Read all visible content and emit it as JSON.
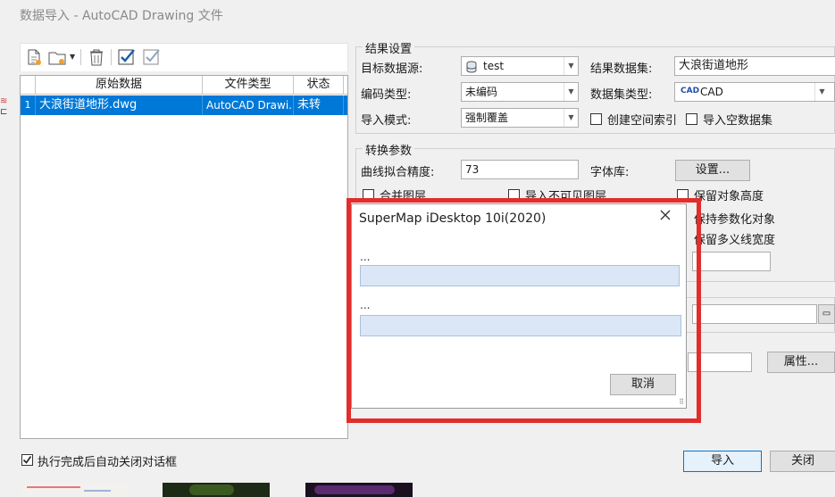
{
  "window": {
    "title": "数据导入 - AutoCAD Drawing 文件"
  },
  "toolbar": {
    "icons": [
      "add-file-icon",
      "add-folder-icon",
      "delete-icon",
      "select-all-icon",
      "select-invert-icon"
    ]
  },
  "table": {
    "columns": [
      "原始数据",
      "文件类型",
      "状态"
    ],
    "rows": [
      {
        "index": "1",
        "name": "大浪街道地形.dwg",
        "type": "AutoCAD Drawi...",
        "status": "未转"
      }
    ]
  },
  "result": {
    "group_title": "结果设置",
    "target_ds_label": "目标数据源:",
    "target_ds_value": "test",
    "result_dataset_label": "结果数据集:",
    "result_dataset_value": "大浪街道地形",
    "encoding_label": "编码类型:",
    "encoding_value": "未编码",
    "dataset_type_label": "数据集类型:",
    "dataset_type_icon": "CAD",
    "dataset_type_value": "CAD",
    "import_mode_label": "导入模式:",
    "import_mode_value": "强制覆盖",
    "spatial_index_label": "创建空间索引",
    "import_empty_label": "导入空数据集"
  },
  "convert": {
    "group_title": "转换参数",
    "curve_label": "曲线拟合精度:",
    "curve_value": "73",
    "font_label": "字体库:",
    "settings_button": "设置...",
    "merge_layers_label": "合并图层",
    "import_invisible_label": "导入不可见图层",
    "keep_height_label": "保留对象高度",
    "keep_param_label": "保持参数化对象",
    "keep_polyline_label": "保留多义线宽度"
  },
  "properties_button": "属性...",
  "auto_close_label": "执行完成后自动关闭对话框",
  "import_button": "导入",
  "close_button": "关闭",
  "progress": {
    "title": "SuperMap iDesktop 10i(2020)",
    "label1": "...",
    "label2": "...",
    "progress1": 0,
    "progress2": 0,
    "cancel_button": "取消"
  }
}
